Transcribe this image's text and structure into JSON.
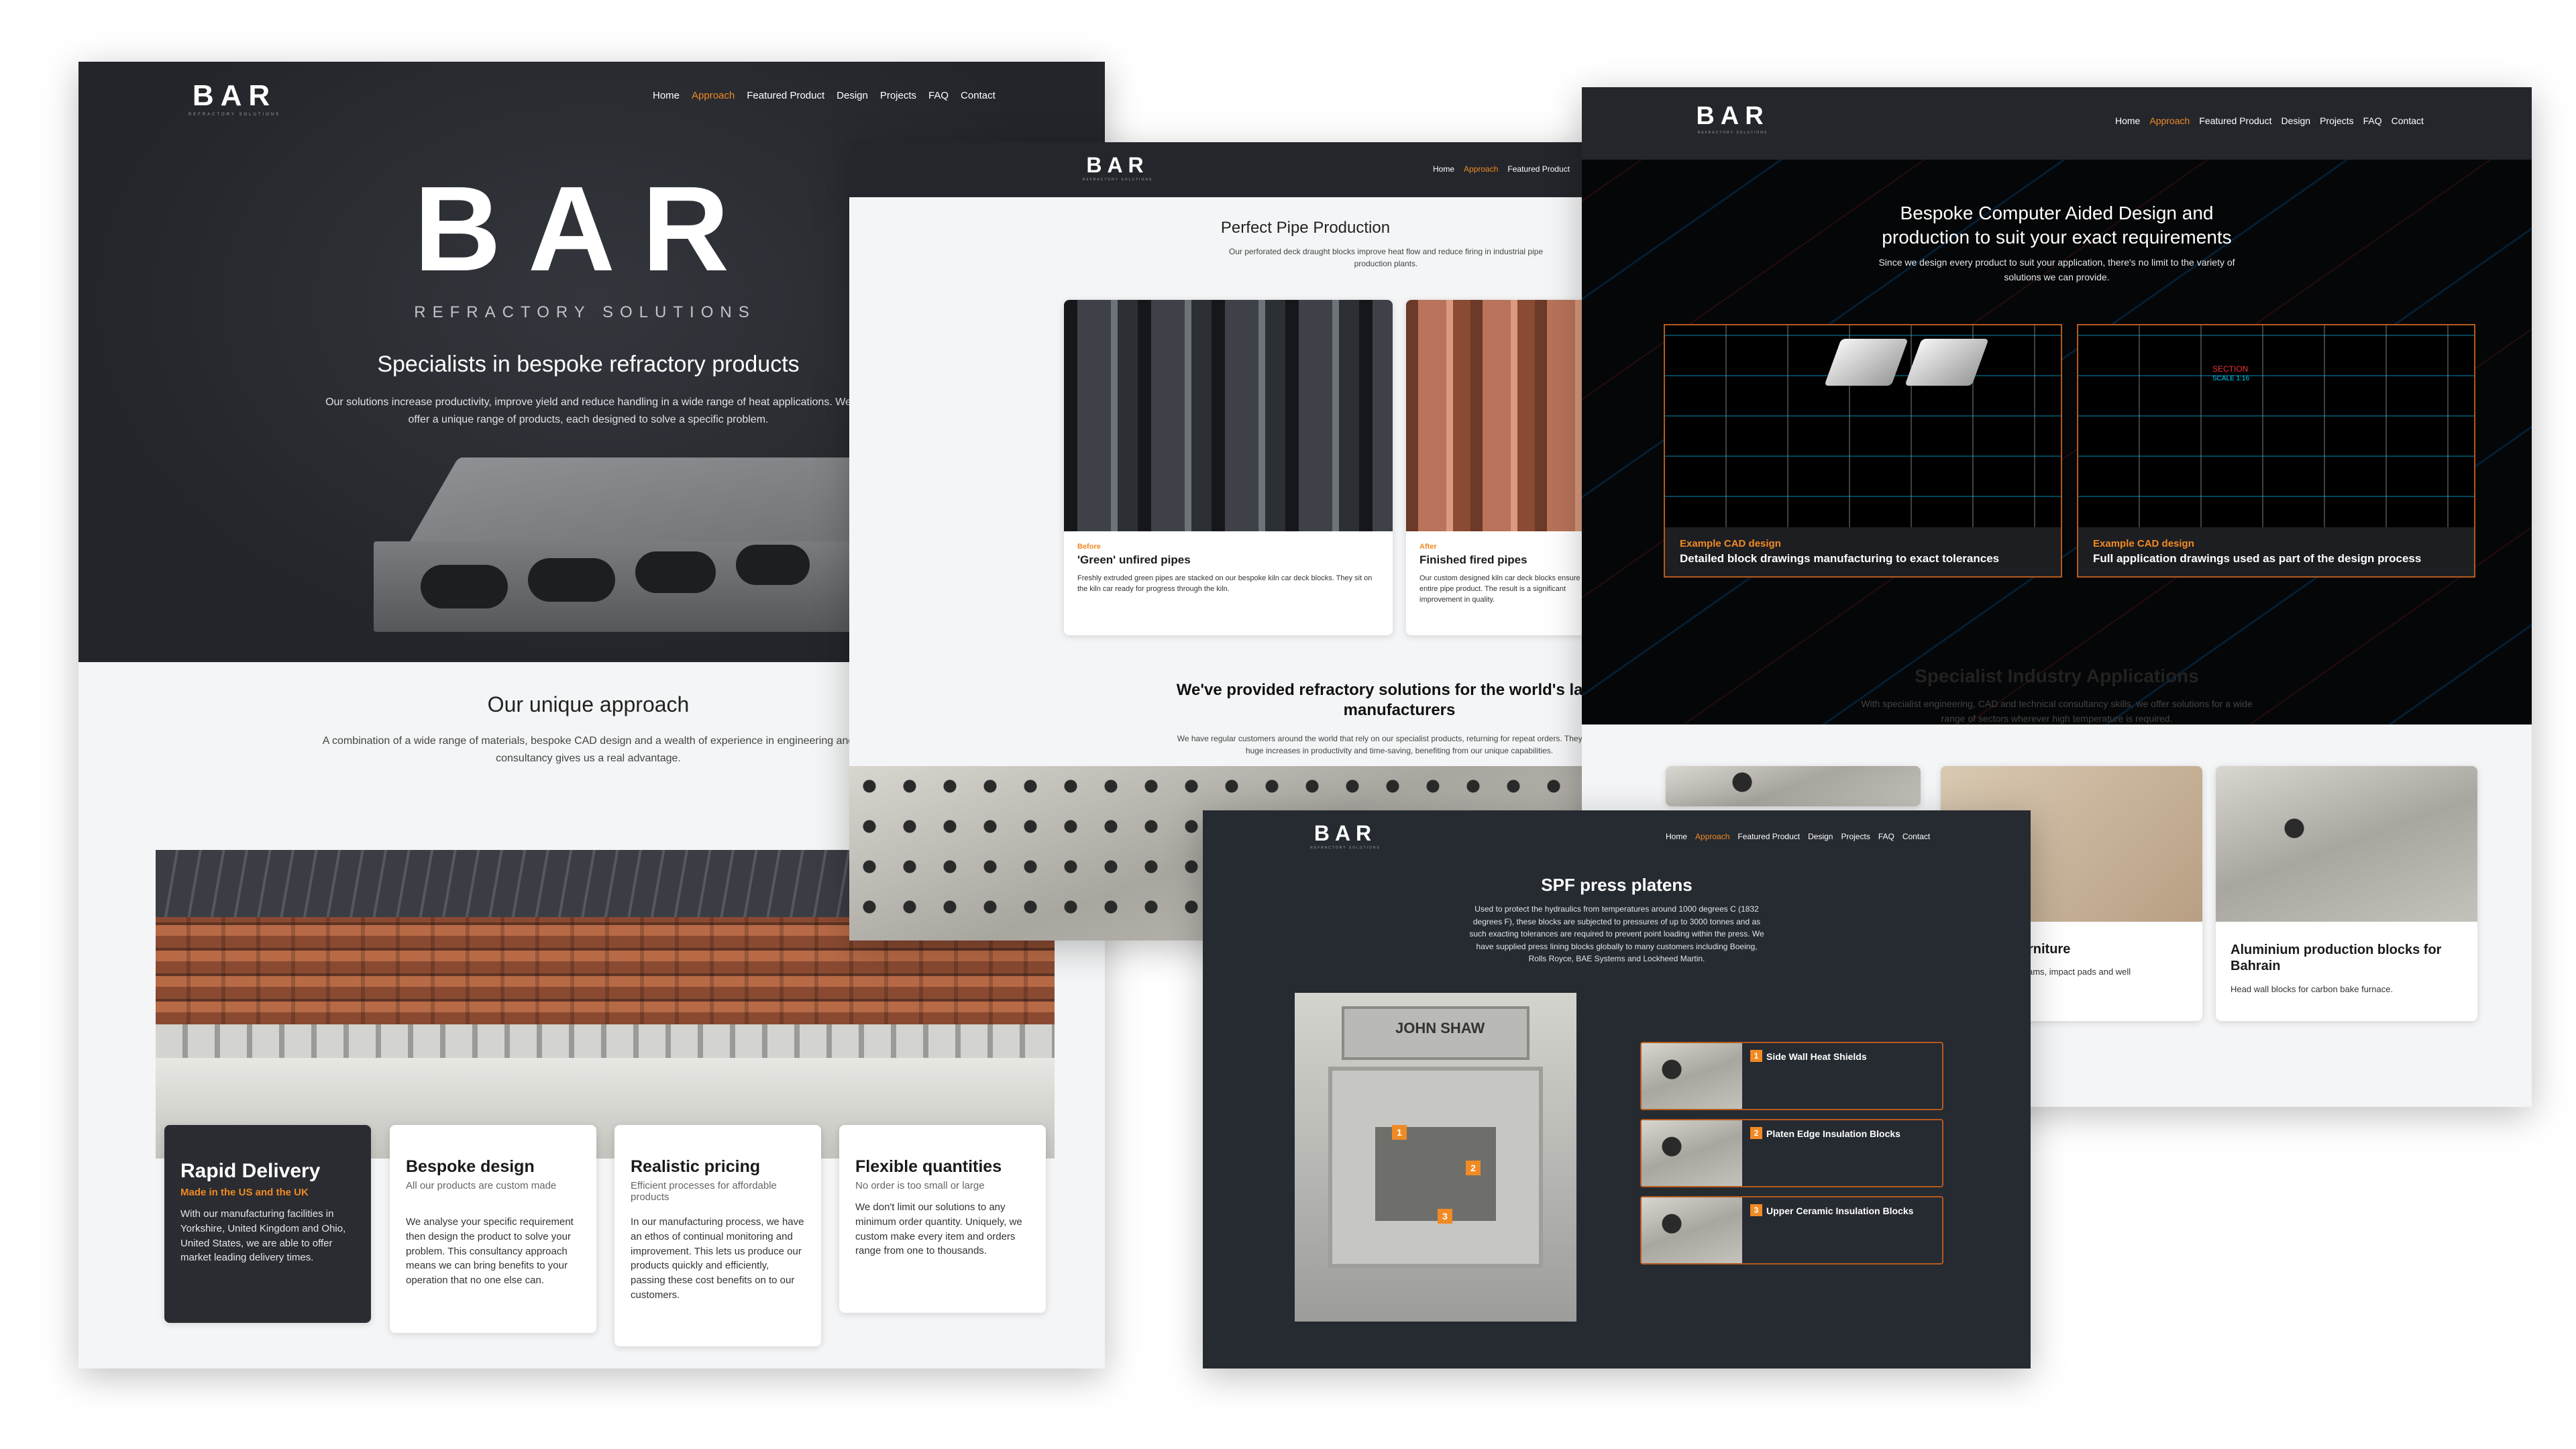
{
  "nav": {
    "items": [
      "Home",
      "Approach",
      "Featured Product",
      "Design",
      "Projects",
      "FAQ",
      "Contact"
    ],
    "active": "Approach"
  },
  "brand": {
    "wordmark": "BAR",
    "tagline": "REFRACTORY SOLUTIONS"
  },
  "hero": {
    "title": "Specialists in bespoke refractory products",
    "body": "Our solutions increase productivity, improve yield and reduce handling in a wide range of heat applications. We offer a unique range of products, each designed to solve a specific problem."
  },
  "approach": {
    "title": "Our unique approach",
    "body": "A combination of a wide range of materials, bespoke CAD design and a wealth of experience in engineering and consultancy gives us a real advantage.",
    "cards": [
      {
        "title": "Rapid Delivery",
        "subtitle": "Made in the US and the UK",
        "body": "With our manufacturing facilities in Yorkshire, United Kingdom and Ohio, United States, we are able to offer market leading delivery times."
      },
      {
        "title": "Bespoke design",
        "subtitle": "All our products are custom made",
        "body": "We analyse your specific requirement then design the product to solve your problem. This consultancy approach means we can bring benefits to your operation that no one else can."
      },
      {
        "title": "Realistic pricing",
        "subtitle": "Efficient processes for affordable products",
        "body": "In our manufacturing process, we have an ethos of continual monitoring and improvement. This lets us produce our products quickly and efficiently, passing these cost benefits on to our customers."
      },
      {
        "title": "Flexible quantities",
        "subtitle": "No order is too small or large",
        "body": "We don't limit our solutions to any minimum order quantity. Uniquely, we custom make every item and orders range from one to thousands."
      }
    ]
  },
  "pipes": {
    "title": "Perfect Pipe Production",
    "body": "Our perforated deck draught blocks improve heat flow and reduce firing in industrial pipe production plants.",
    "cards": [
      {
        "tag": "Before",
        "title": "'Green' unfired pipes",
        "body": "Freshly extruded green pipes are stacked on our bespoke kiln car deck blocks. They sit on the kiln car ready for progress through the kiln."
      },
      {
        "tag": "After",
        "title": "Finished fired pipes",
        "body": "Our custom designed kiln car deck blocks ensure the entire pipe product. The result is a significant improvement in quality."
      }
    ],
    "world_title": "We've provided refractory solutions for the world's largest manufacturers",
    "world_body": "We have regular customers around the world that rely on our specialist products, returning for repeat orders. They have seen huge increases in productivity and time-saving, benefiting from our unique capabilities."
  },
  "cad": {
    "title": "Bespoke Computer Aided Design and production to suit your exact requirements",
    "body": "Since we design every product to suit your application, there's no limit to the variety of solutions we can provide.",
    "cards": [
      {
        "tag": "Example CAD design",
        "title": "Detailed block drawings manufacturing to exact tolerances"
      },
      {
        "tag": "Example CAD design",
        "title": "Full application drawings used as part of the design process"
      }
    ],
    "drawing_labels": [
      "SECTION",
      "SCALE 1:16"
    ]
  },
  "industry": {
    "title": "Specialist Industry Applications",
    "body": "With specialist engineering, CAD and technical consultancy skills, we offer solutions for a wide range of sectors wherever high temperature is required.",
    "cards": [
      {
        "title": "rniture",
        "body": "ams, impact pads and well"
      },
      {
        "title": "Aluminium production blocks for Bahrain",
        "body": "Head wall blocks for carbon bake furnace."
      }
    ]
  },
  "spf": {
    "title": "SPF press platens",
    "body": "Used to protect the hydraulics from temperatures around 1000 degrees C (1832 degrees F), these blocks are subjected to pressures of up to 3000 tonnes and as such exacting tolerances are required to prevent point loading within the press. We have supplied press lining blocks globally to many customers including Boeing, Rolls Royce, BAE Systems and Lockheed Martin.",
    "press_brand": "JOHN SHAW",
    "items": [
      {
        "num": "1",
        "label": "Side Wall Heat Shields"
      },
      {
        "num": "2",
        "label": "Platen Edge Insulation Blocks"
      },
      {
        "num": "3",
        "label": "Upper Ceramic Insulation Blocks"
      }
    ]
  },
  "colors": {
    "accent": "#f08a24",
    "dark": "#24262b"
  }
}
